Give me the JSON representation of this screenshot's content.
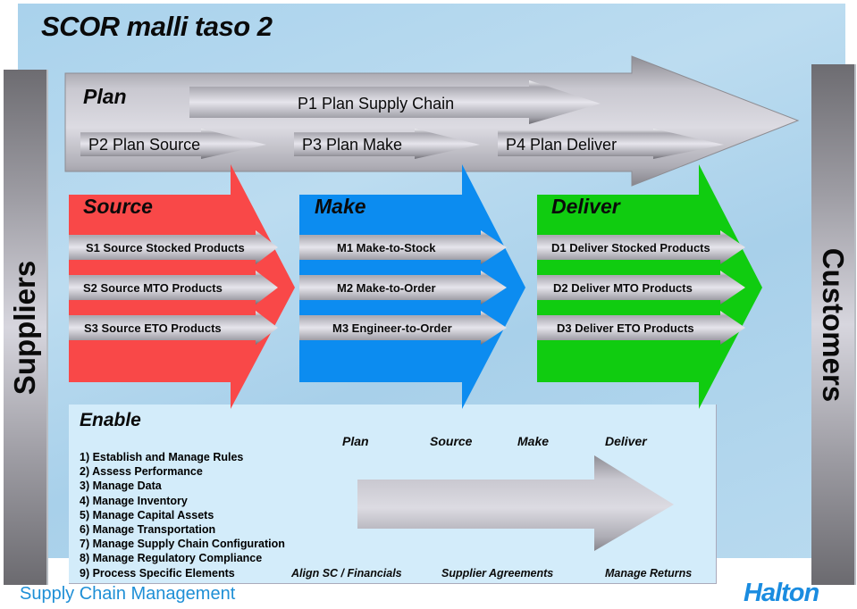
{
  "title": "SCOR malli taso 2",
  "suppliers_label": "Suppliers",
  "customers_label": "Customers",
  "plan": {
    "title": "Plan",
    "items": [
      "P1  Plan Supply Chain",
      "P2  Plan Source",
      "P3  Plan Make",
      "P4  Plan Deliver"
    ]
  },
  "source": {
    "title": "Source",
    "color": "#f94848",
    "items": [
      "S1  Source Stocked Products",
      "S2  Source MTO Products",
      "S3  Source ETO Products"
    ]
  },
  "make": {
    "title": "Make",
    "color": "#0c8cf0",
    "items": [
      "M1  Make-to-Stock",
      "M2  Make-to-Order",
      "M3  Engineer-to-Order"
    ]
  },
  "deliver": {
    "title": "Deliver",
    "color": "#10cc10",
    "items": [
      "D1  Deliver Stocked Products",
      "D2  Deliver MTO Products",
      "D3 Deliver ETO Products"
    ]
  },
  "enable": {
    "title": "Enable",
    "items": [
      "1) Establish and Manage Rules",
      "2) Assess Performance",
      "3) Manage Data",
      "4) Manage Inventory",
      "5) Manage Capital Assets",
      "6) Manage Transportation",
      "7) Manage Supply Chain Configuration",
      "8) Manage Regulatory Compliance",
      "9) Process Specific Elements"
    ],
    "column_labels": [
      "Plan",
      "Source",
      "Make",
      "Deliver"
    ],
    "bottom_labels": [
      "Align SC / Financials",
      "Supplier Agreements",
      "Manage Returns"
    ]
  },
  "footer": "Supply Chain Management",
  "logo": "Halton"
}
